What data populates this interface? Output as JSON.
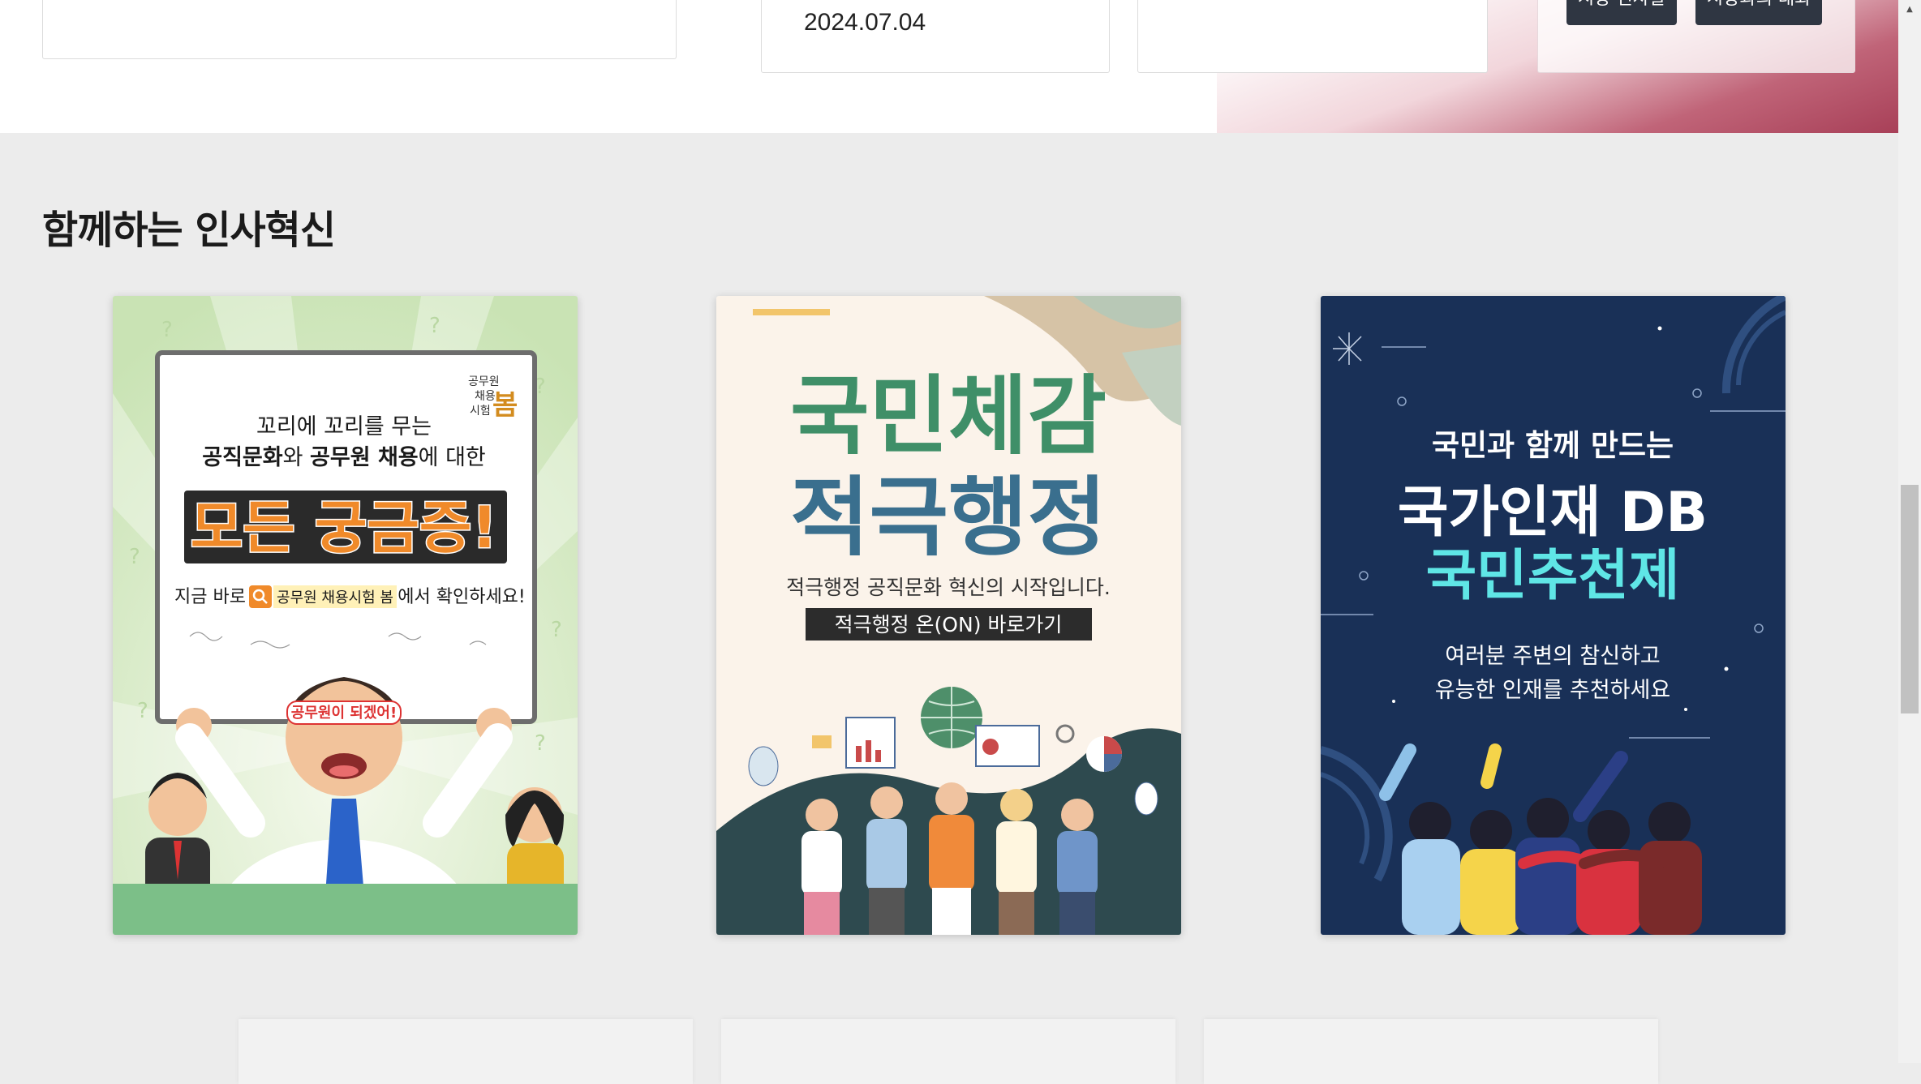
{
  "top": {
    "date": "2024.07.04",
    "mayor_buttons": [
      "시장 인사말",
      "시장과의 대화"
    ]
  },
  "section": {
    "title": "함께하는 인사혁신"
  },
  "banners": [
    {
      "logo": [
        "공무원",
        "채용",
        "시험",
        "봄"
      ],
      "line1": "꼬리에 꼬리를 무는",
      "line2_a": "공직문화",
      "line2_b": "와 ",
      "line2_c": "공무원 채용",
      "line2_d": "에 대한",
      "headline": "모든 궁금증!",
      "cta_pre": "지금 바로",
      "cta_tag": "공무원 채용시험 봄",
      "cta_post": "에서 확인하세요!",
      "headband": "공무원이 되겠어!"
    },
    {
      "headline1": "국민체감",
      "headline2": "적극행정",
      "subtitle": "적극행정 공직문화 혁신의 시작입니다.",
      "button": "적극행정 온(ON) 바로가기"
    },
    {
      "line1": "국민과 함께 만드는",
      "line2": "국가인재 DB",
      "line3": "국민추천제",
      "desc1": "여러분 주변의 참신하고",
      "desc2": "유능한 인재를 추천하세요"
    }
  ],
  "colors": {
    "banner1_bg": "#d8ecc8",
    "banner1_accent": "#f08a2a",
    "banner2_bg": "#fbf3ea",
    "banner2_green": "#3f8f68",
    "banner2_blue": "#3a6f8e",
    "banner3_bg": "#193057",
    "banner3_cyan": "#5fe6e6",
    "mayor_btn": "#2f3642"
  },
  "icons": [
    "prev-arrow-icon",
    "pause-icon",
    "next-arrow-icon",
    "search-icon",
    "scroll-up-arrow-icon"
  ]
}
